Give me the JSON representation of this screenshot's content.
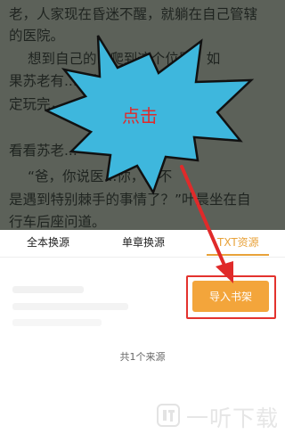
{
  "reader": {
    "lines": [
      "老，人家现在昏迷不醒，就躺在自己管辖",
      "的医院。",
      "想到自己的...爬到这个位置，如",
      "果苏老有...的位置肯定",
      "定玩完，...走。",
      "...也他去",
      "看看苏老...",
      "“爸，你说医...你，是不",
      "是遇到特别棘手的事情了？”叶晨坐在自",
      "行车后座问道。"
    ],
    "background": "#5c6159"
  },
  "annotation": {
    "label": "点击",
    "burst_color": "#3eb7dd",
    "label_color": "#e02a2a"
  },
  "sheet": {
    "tabs": [
      {
        "label": "全本换源"
      },
      {
        "label": "单章换源"
      },
      {
        "label": "TXT资源",
        "active": true
      }
    ],
    "import_button": "导入书架",
    "source_count": "共1个来源",
    "accent": "#f3a53b"
  },
  "watermark": {
    "text": "一听下载",
    "icon": "ting-logo-icon"
  }
}
